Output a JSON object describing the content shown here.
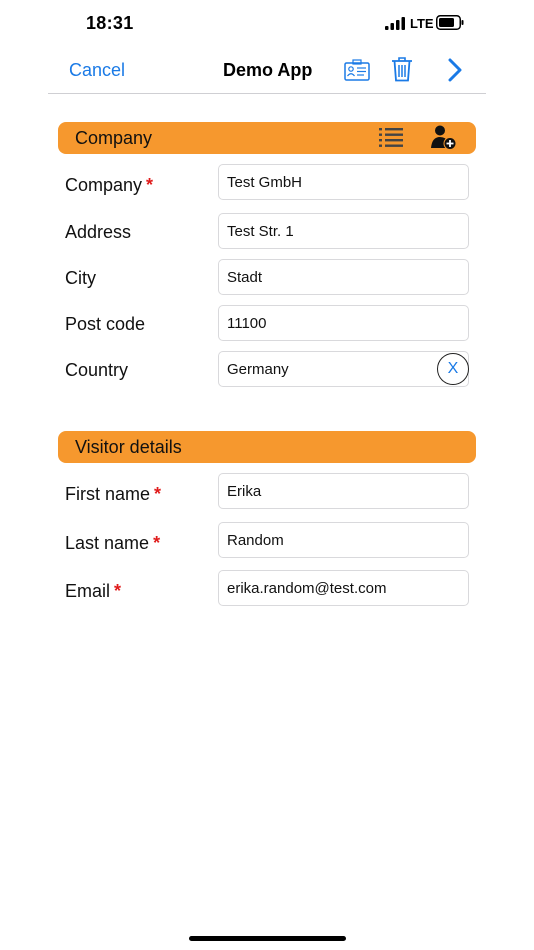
{
  "status_bar": {
    "time": "18:31",
    "network": "LTE"
  },
  "nav": {
    "cancel_label": "Cancel",
    "title": "Demo App",
    "icons": [
      "id-card-icon",
      "trash-icon",
      "chevron-right-icon"
    ]
  },
  "colors": {
    "accent": "#1a7ae6",
    "section": "#f6982e",
    "required": "#e01b1b"
  },
  "company_section": {
    "title": "Company",
    "icons": [
      "list-icon",
      "add-person-icon"
    ],
    "fields": [
      {
        "label": "Company",
        "required": "*",
        "value": "Test GmbH"
      },
      {
        "label": "Address",
        "value": "Test Str. 1"
      },
      {
        "label": "City",
        "value": "Stadt"
      },
      {
        "label": "Post code",
        "value": "11100"
      },
      {
        "label": "Country",
        "value": "Germany",
        "clear_label": "X"
      }
    ]
  },
  "visitor_section": {
    "title": "Visitor details",
    "fields": [
      {
        "label": "First name",
        "required": "*",
        "value": "Erika"
      },
      {
        "label": "Last name",
        "required": "*",
        "value": "Random"
      },
      {
        "label": "Email",
        "required": "*",
        "value": "erika.random@test.com"
      }
    ]
  }
}
